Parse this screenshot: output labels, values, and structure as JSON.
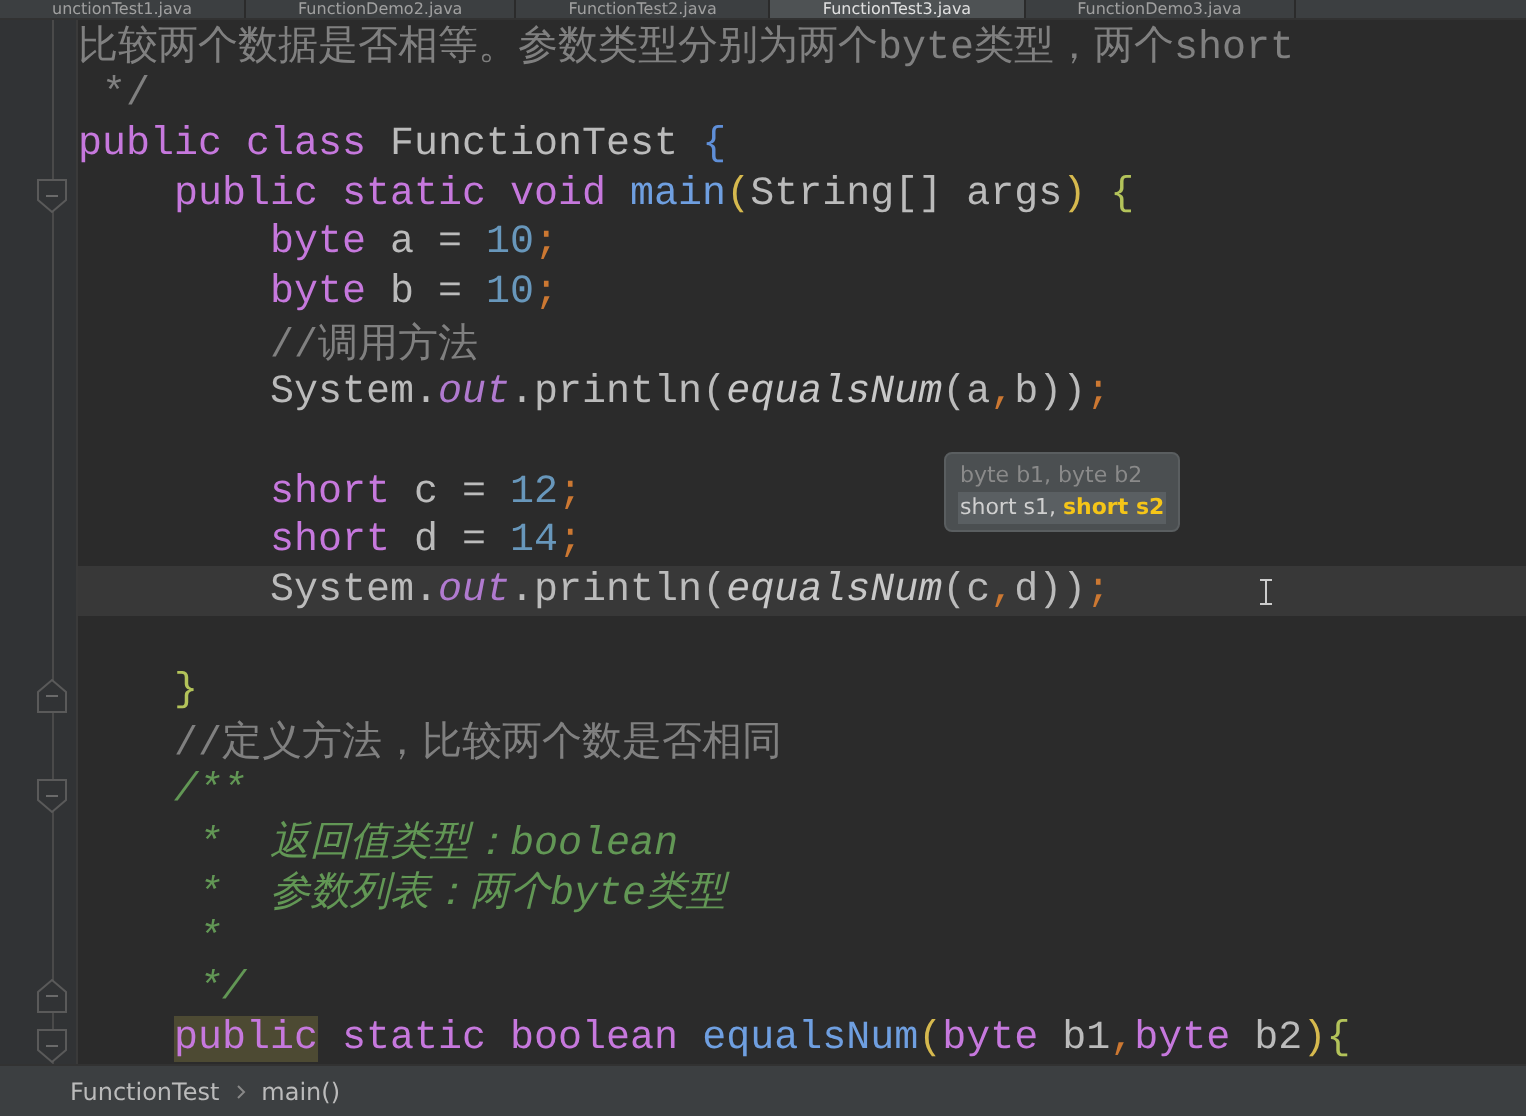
{
  "tabs": [
    {
      "label": "unctionTest1.java",
      "selected": false
    },
    {
      "label": "FunctionDemo2.java",
      "selected": false
    },
    {
      "label": "FunctionTest2.java",
      "selected": false
    },
    {
      "label": "FunctionTest3.java",
      "selected": true
    },
    {
      "label": "FunctionDemo3.java",
      "selected": false
    }
  ],
  "code_lines": [
    {
      "current": false,
      "tokens": [
        {
          "text": "比较两个数据是否相等。参数类型分别为两个byte类型，两个short",
          "kind": "comment"
        }
      ]
    },
    {
      "current": false,
      "tokens": [
        {
          "text": " */",
          "kind": "comment"
        }
      ]
    },
    {
      "current": false,
      "tokens": [
        {
          "text": "public class ",
          "kind": "kw"
        },
        {
          "text": "FunctionTest ",
          "kind": "plain"
        },
        {
          "text": "{",
          "kind": "outer"
        }
      ]
    },
    {
      "current": false,
      "fold": {
        "kind": "start"
      },
      "tokens": [
        {
          "text": "    public static void ",
          "kind": "kw"
        },
        {
          "text": "main",
          "kind": "decl"
        },
        {
          "text": "(",
          "kind": "paren"
        },
        {
          "text": "String[] args",
          "kind": "plain"
        },
        {
          "text": ") ",
          "kind": "paren"
        },
        {
          "text": "{",
          "kind": "brace"
        }
      ]
    },
    {
      "current": false,
      "tokens": [
        {
          "text": "        byte ",
          "kind": "kw"
        },
        {
          "text": "a = ",
          "kind": "plain"
        },
        {
          "text": "10",
          "kind": "num"
        },
        {
          "text": ";",
          "kind": "punc"
        }
      ]
    },
    {
      "current": false,
      "tokens": [
        {
          "text": "        byte ",
          "kind": "kw"
        },
        {
          "text": "b = ",
          "kind": "plain"
        },
        {
          "text": "10",
          "kind": "num"
        },
        {
          "text": ";",
          "kind": "punc"
        }
      ]
    },
    {
      "current": false,
      "tokens": [
        {
          "text": "        //调用方法",
          "kind": "comment"
        }
      ]
    },
    {
      "current": false,
      "tokens": [
        {
          "text": "        System.",
          "kind": "plain"
        },
        {
          "text": "out",
          "kind": "field"
        },
        {
          "text": ".println(",
          "kind": "plain"
        },
        {
          "text": "equalsNum",
          "kind": "call"
        },
        {
          "text": "(a",
          "kind": "plain"
        },
        {
          "text": ",",
          "kind": "punc"
        },
        {
          "text": "b))",
          "kind": "plain"
        },
        {
          "text": ";",
          "kind": "punc"
        }
      ]
    },
    {
      "current": false
    },
    {
      "current": false,
      "tokens": [
        {
          "text": "        short ",
          "kind": "kw"
        },
        {
          "text": "c = ",
          "kind": "plain"
        },
        {
          "text": "12",
          "kind": "num"
        },
        {
          "text": ";",
          "kind": "punc"
        }
      ]
    },
    {
      "current": false,
      "tokens": [
        {
          "text": "        short ",
          "kind": "kw"
        },
        {
          "text": "d = ",
          "kind": "plain"
        },
        {
          "text": "14",
          "kind": "num"
        },
        {
          "text": ";",
          "kind": "punc"
        }
      ]
    },
    {
      "current": true,
      "tokens": [
        {
          "text": "        System.",
          "kind": "plain"
        },
        {
          "text": "out",
          "kind": "field"
        },
        {
          "text": ".println(",
          "kind": "plain"
        },
        {
          "text": "equalsNum",
          "kind": "call"
        },
        {
          "text": "(c",
          "kind": "plain"
        },
        {
          "text": ",",
          "kind": "punc"
        },
        {
          "text": "d))",
          "kind": "plain"
        },
        {
          "text": ";",
          "kind": "punc"
        }
      ]
    },
    {
      "current": false
    },
    {
      "current": false,
      "fold": {
        "kind": "end"
      },
      "tokens": [
        {
          "text": "    }",
          "kind": "brace"
        }
      ]
    },
    {
      "current": false,
      "tokens": [
        {
          "text": "    //定义方法，比较两个数是否相同",
          "kind": "comment"
        }
      ]
    },
    {
      "current": false,
      "fold": {
        "kind": "start"
      },
      "tokens": [
        {
          "text": "    /**",
          "kind": "doc"
        }
      ]
    },
    {
      "current": false,
      "tokens": [
        {
          "text": "     *  返回值类型：boolean",
          "kind": "doc"
        }
      ]
    },
    {
      "current": false,
      "tokens": [
        {
          "text": "     *  参数列表：两个byte类型",
          "kind": "doc"
        }
      ]
    },
    {
      "current": false,
      "tokens": [
        {
          "text": "     *",
          "kind": "doc"
        }
      ]
    },
    {
      "current": false,
      "fold": {
        "kind": "end"
      },
      "tokens": [
        {
          "text": "     */",
          "kind": "doc"
        }
      ]
    },
    {
      "current": false,
      "fold": {
        "kind": "start"
      },
      "tokens": [
        {
          "text": "    public",
          "kind": "marked"
        },
        {
          "text": " static boolean ",
          "kind": "kw"
        },
        {
          "text": "equalsNum",
          "kind": "decl"
        },
        {
          "text": "(",
          "kind": "paren"
        },
        {
          "text": "byte ",
          "kind": "kw"
        },
        {
          "text": "b1",
          "kind": "plain"
        },
        {
          "text": ",",
          "kind": "punc"
        },
        {
          "text": "byte ",
          "kind": "kw"
        },
        {
          "text": "b2",
          "kind": "plain"
        },
        {
          "text": ")",
          "kind": "paren"
        },
        {
          "text": "{",
          "kind": "brace"
        }
      ]
    }
  ],
  "parameter_hint": [
    {
      "selected": false,
      "parts": [
        {
          "text": "byte b1, byte b2",
          "current": false
        }
      ]
    },
    {
      "selected": true,
      "parts": [
        {
          "text": "short s1, ",
          "current": false
        },
        {
          "text": "short s2",
          "current": true
        }
      ]
    }
  ],
  "breadcrumb": [
    "FunctionTest",
    "main()"
  ]
}
